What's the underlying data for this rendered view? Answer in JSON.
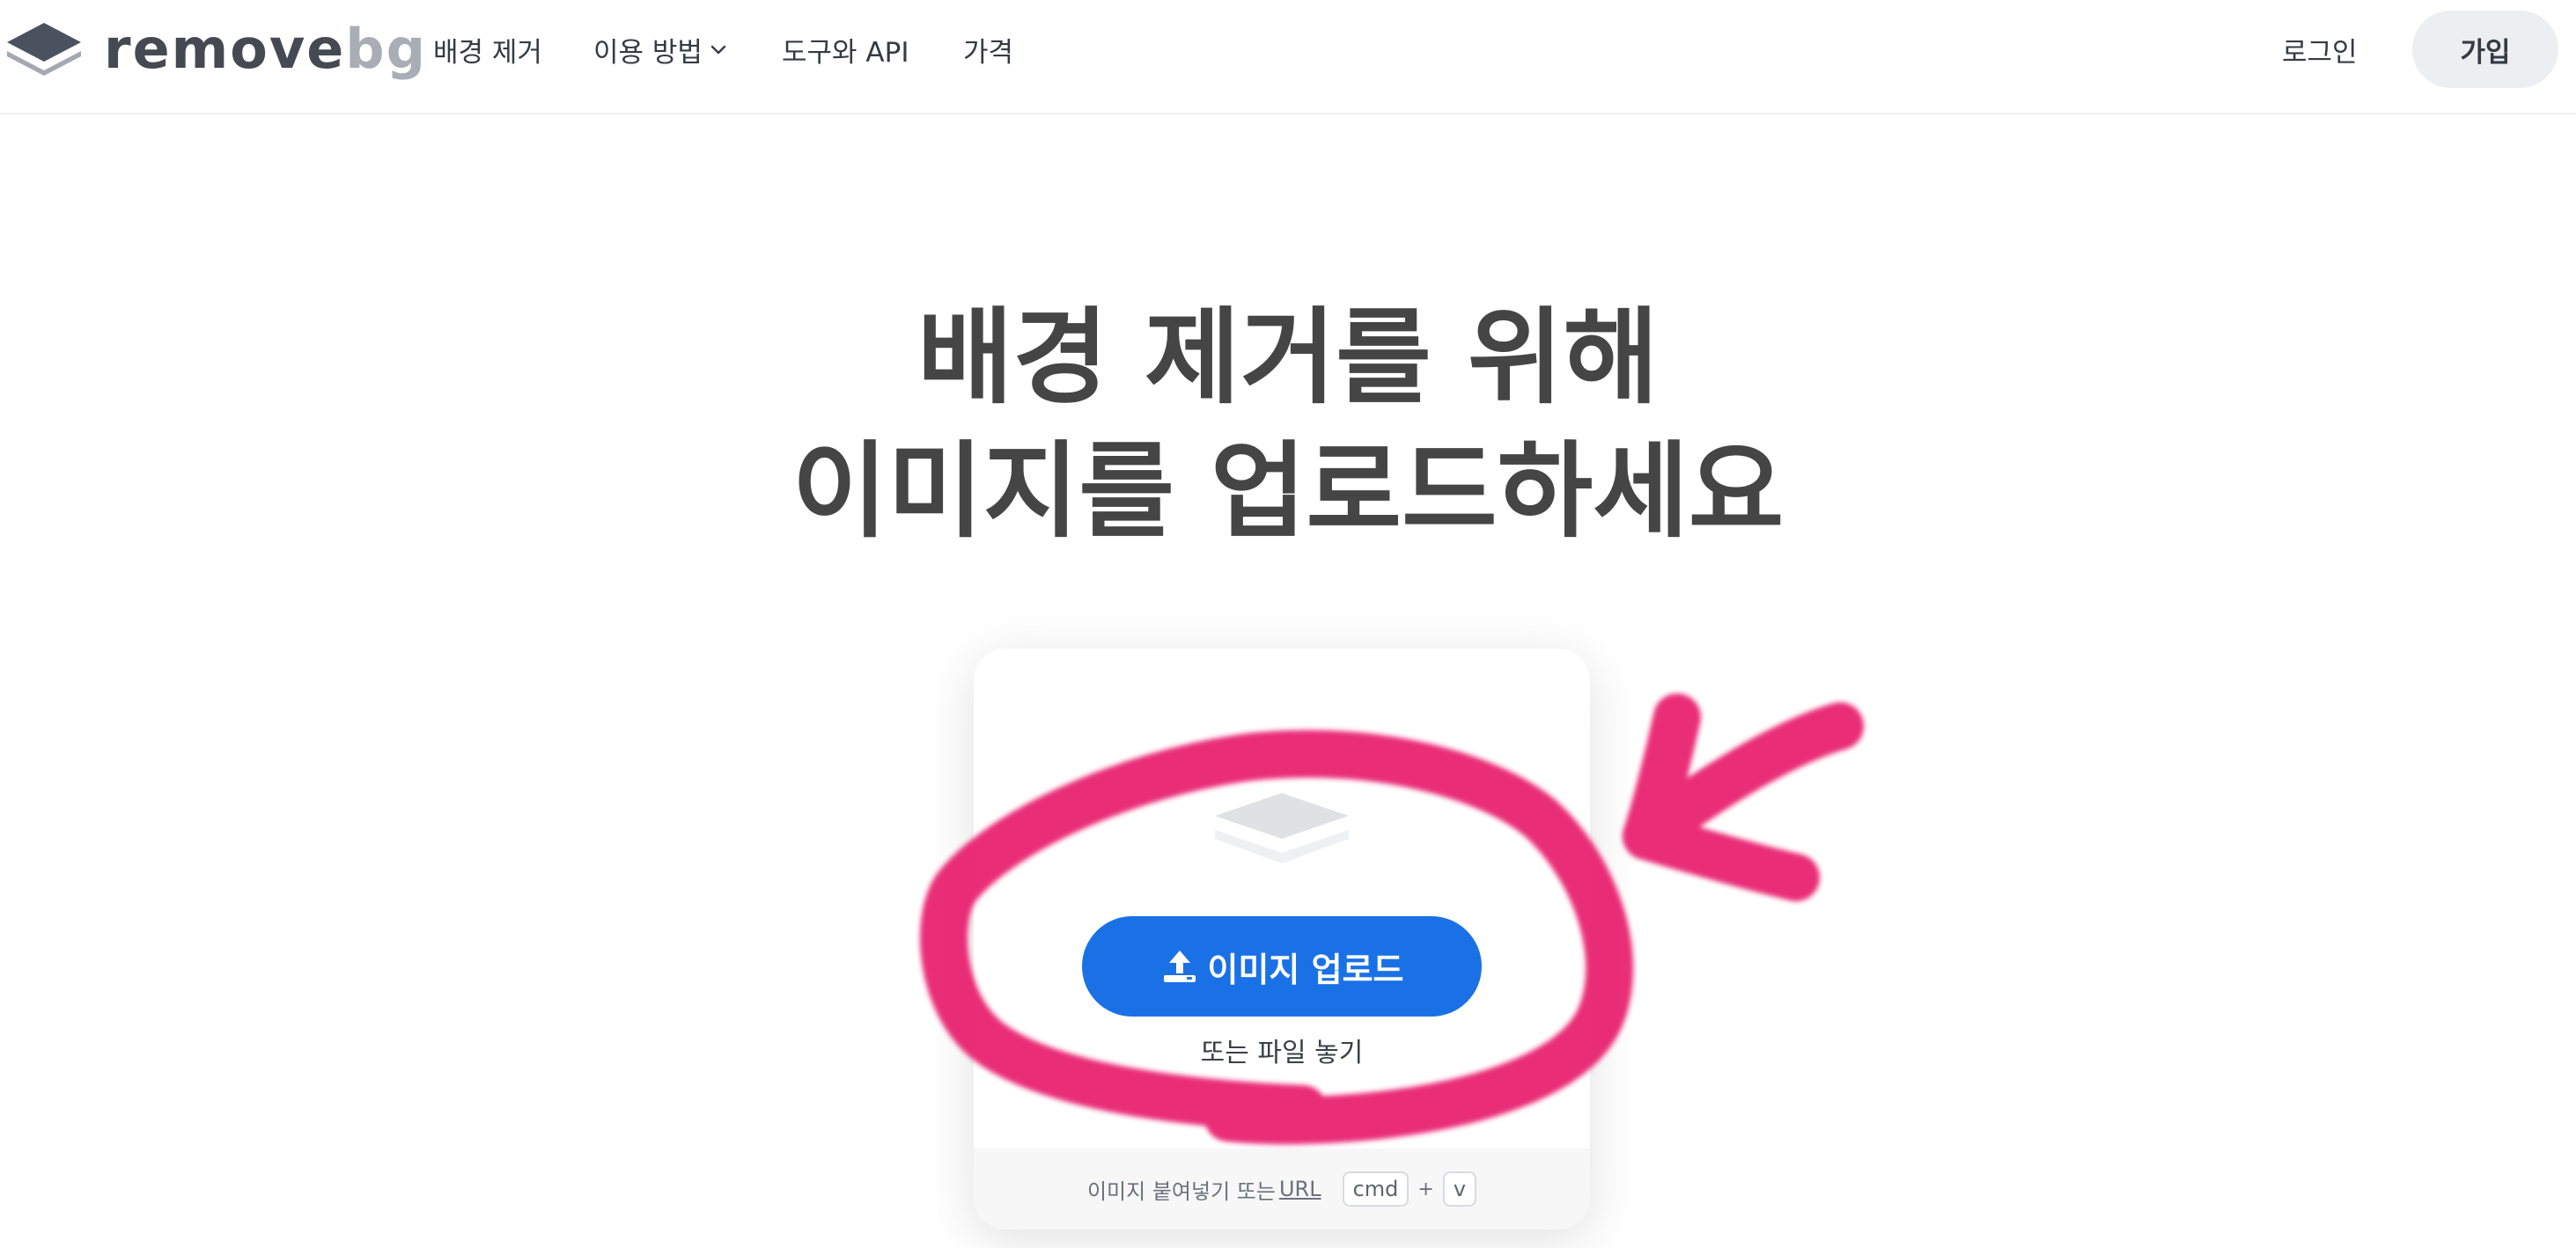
{
  "header": {
    "logo": {
      "icon": "layers-icon",
      "text_main": "remove",
      "text_accent": "bg"
    },
    "nav": [
      {
        "label": "배경 제거"
      },
      {
        "label": "이용 방법",
        "icon": "chevron-down-icon"
      },
      {
        "label": "도구와 API"
      },
      {
        "label": "가격"
      }
    ],
    "login_label": "로그인",
    "signup_label": "가입"
  },
  "hero": {
    "title_line1": "배경 제거를 위해",
    "title_line2": "이미지를 업로드하세요"
  },
  "upload_card": {
    "illustration": "layers-icon",
    "button_label": "이미지 업로드",
    "button_icon": "upload-icon",
    "drop_text": "또는 파일 놓기",
    "footer_text": "이미지 붙여넣기 또는",
    "footer_link": "URL",
    "shortcut_key1": "cmd",
    "shortcut_plus": "+",
    "shortcut_key2": "v"
  },
  "colors": {
    "primary_button": "#1a71e6",
    "annotation_pink": "#e8246f",
    "title_text": "#454545"
  }
}
